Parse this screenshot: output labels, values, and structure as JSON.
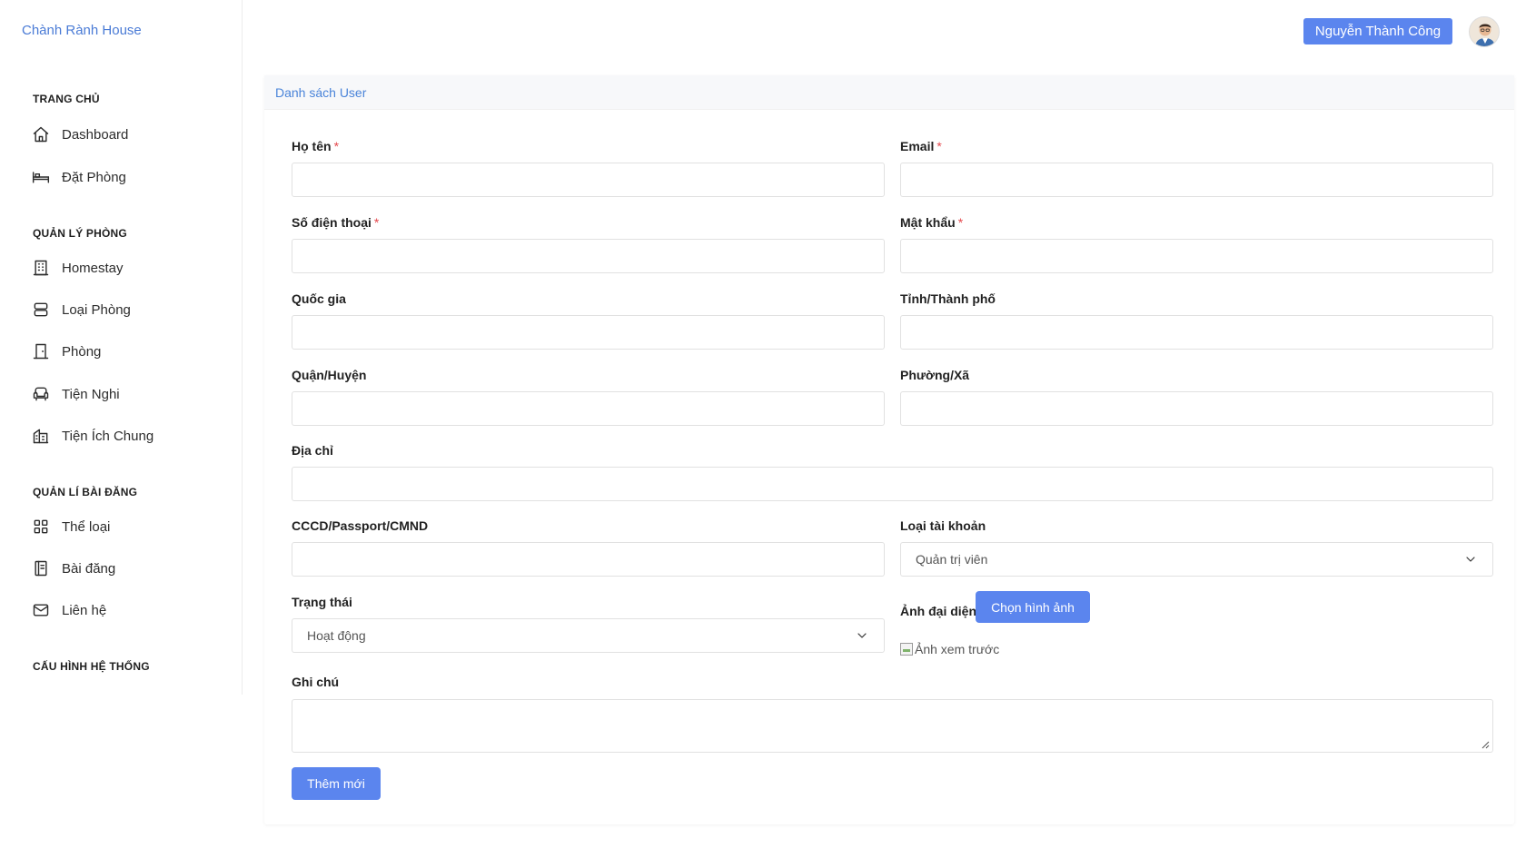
{
  "brand": "Chành Rành House",
  "header": {
    "user_name": "Nguyễn Thành Công",
    "accent": "#5b85ee"
  },
  "sidebar": {
    "sections": [
      {
        "title": "TRANG CHỦ",
        "items": [
          {
            "label": "Dashboard",
            "icon": "home-icon"
          },
          {
            "label": "Đặt Phòng",
            "icon": "bed-icon"
          }
        ]
      },
      {
        "title": "QUẢN LÝ PHÒNG",
        "items": [
          {
            "label": "Homestay",
            "icon": "building-icon"
          },
          {
            "label": "Loại Phòng",
            "icon": "server-icon"
          },
          {
            "label": "Phòng",
            "icon": "door-icon"
          },
          {
            "label": "Tiện Nghi",
            "icon": "sofa-icon"
          },
          {
            "label": "Tiện Ích Chung",
            "icon": "buildings-icon"
          }
        ]
      },
      {
        "title": "QUẢN LÍ BÀI ĐĂNG",
        "items": [
          {
            "label": "Thể loại",
            "icon": "grid-icon"
          },
          {
            "label": "Bài đăng",
            "icon": "notebook-icon"
          },
          {
            "label": "Liên hệ",
            "icon": "mail-icon"
          }
        ]
      },
      {
        "title": "CẤU HÌNH HỆ THỐNG",
        "items": []
      }
    ]
  },
  "card": {
    "title": "Danh sách User",
    "fields": {
      "fullname": {
        "label": "Họ tên",
        "required": "*",
        "value": ""
      },
      "email": {
        "label": "Email",
        "required": "*",
        "value": ""
      },
      "phone": {
        "label": "Số điện thoại",
        "required": "*",
        "value": ""
      },
      "password": {
        "label": "Mật khẩu",
        "required": "*",
        "value": ""
      },
      "country": {
        "label": "Quốc gia",
        "value": ""
      },
      "province": {
        "label": "Tỉnh/Thành phố",
        "value": ""
      },
      "district": {
        "label": "Quận/Huyện",
        "value": ""
      },
      "ward": {
        "label": "Phường/Xã",
        "value": ""
      },
      "address": {
        "label": "Địa chỉ",
        "value": ""
      },
      "id_number": {
        "label": "CCCD/Passport/CMND",
        "value": ""
      },
      "account_type": {
        "label": "Loại tài khoản",
        "selected": "Quản trị viên"
      },
      "status": {
        "label": "Trạng thái",
        "selected": "Hoạt động"
      },
      "avatar": {
        "label": "Ảnh đại diện",
        "button": "Chọn hình ảnh",
        "preview_alt": "Ảnh xem trước"
      },
      "note": {
        "label": "Ghi chú",
        "value": ""
      }
    },
    "submit_label": "Thêm mới"
  }
}
